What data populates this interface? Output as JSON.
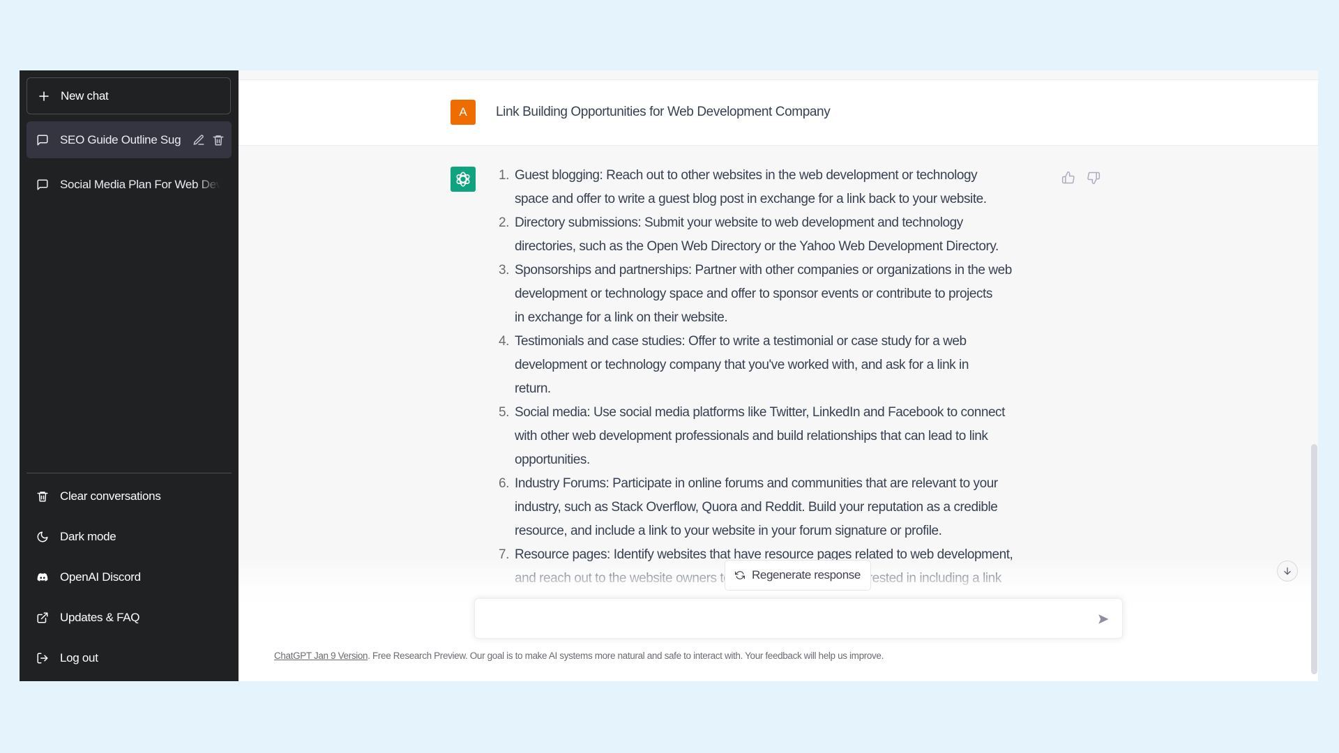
{
  "sidebar": {
    "new_chat_label": "New chat",
    "conversations": [
      {
        "title": "SEO Guide Outline Sug",
        "active": true
      },
      {
        "title": "Social Media Plan For Web Dev",
        "active": false
      }
    ],
    "menu": [
      {
        "label": "Clear conversations",
        "icon": "trash-icon"
      },
      {
        "label": "Dark mode",
        "icon": "moon-icon"
      },
      {
        "label": "OpenAI Discord",
        "icon": "discord-icon"
      },
      {
        "label": "Updates & FAQ",
        "icon": "external-link-icon"
      },
      {
        "label": "Log out",
        "icon": "logout-icon"
      }
    ]
  },
  "chat": {
    "user": {
      "avatar_letter": "A",
      "avatar_color": "#ef6c00",
      "message": "Link Building Opportunities for Web Development Company"
    },
    "assistant": {
      "avatar_color": "#10a37f",
      "items": [
        {
          "num": "1.",
          "lines": [
            "Guest blogging: Reach out to other websites in the web development or technology",
            "space and offer to write a guest blog post in exchange for a link back to your website."
          ]
        },
        {
          "num": "2.",
          "lines": [
            "Directory submissions: Submit your website to web development and technology",
            "directories, such as the Open Web Directory or the Yahoo Web Development Directory."
          ]
        },
        {
          "num": "3.",
          "lines": [
            "Sponsorships and partnerships: Partner with other companies or organizations in the web",
            "development or technology space and offer to sponsor events or contribute to projects",
            "in exchange for a link on their website."
          ]
        },
        {
          "num": "4.",
          "lines": [
            "Testimonials and case studies: Offer to write a testimonial or case study for a web",
            "development or technology company that you've worked with, and ask for a link in",
            "return."
          ]
        },
        {
          "num": "5.",
          "lines": [
            "Social media: Use social media platforms like Twitter, LinkedIn and Facebook to connect",
            "with other web development professionals and build relationships that can lead to link",
            "opportunities."
          ]
        },
        {
          "num": "6.",
          "lines": [
            "Industry Forums: Participate in online forums and communities that are relevant to your",
            "industry, such as Stack Overflow, Quora and Reddit. Build your reputation as a credible",
            "resource, and include a link to your website in your forum signature or profile."
          ]
        },
        {
          "num": "7.",
          "lines": [
            "Resource pages: Identify websites that have resource pages related to web development,",
            "and reach out to the website owners to see if they would be interested in including a link"
          ]
        }
      ]
    },
    "regenerate_label": "Regenerate response"
  },
  "composer": {
    "value": "",
    "placeholder": ""
  },
  "footer": {
    "link_text": "ChatGPT Jan 9 Version",
    "text": ". Free Research Preview. Our goal is to make AI systems more natural and safe to interact with. Your feedback will help us improve."
  }
}
